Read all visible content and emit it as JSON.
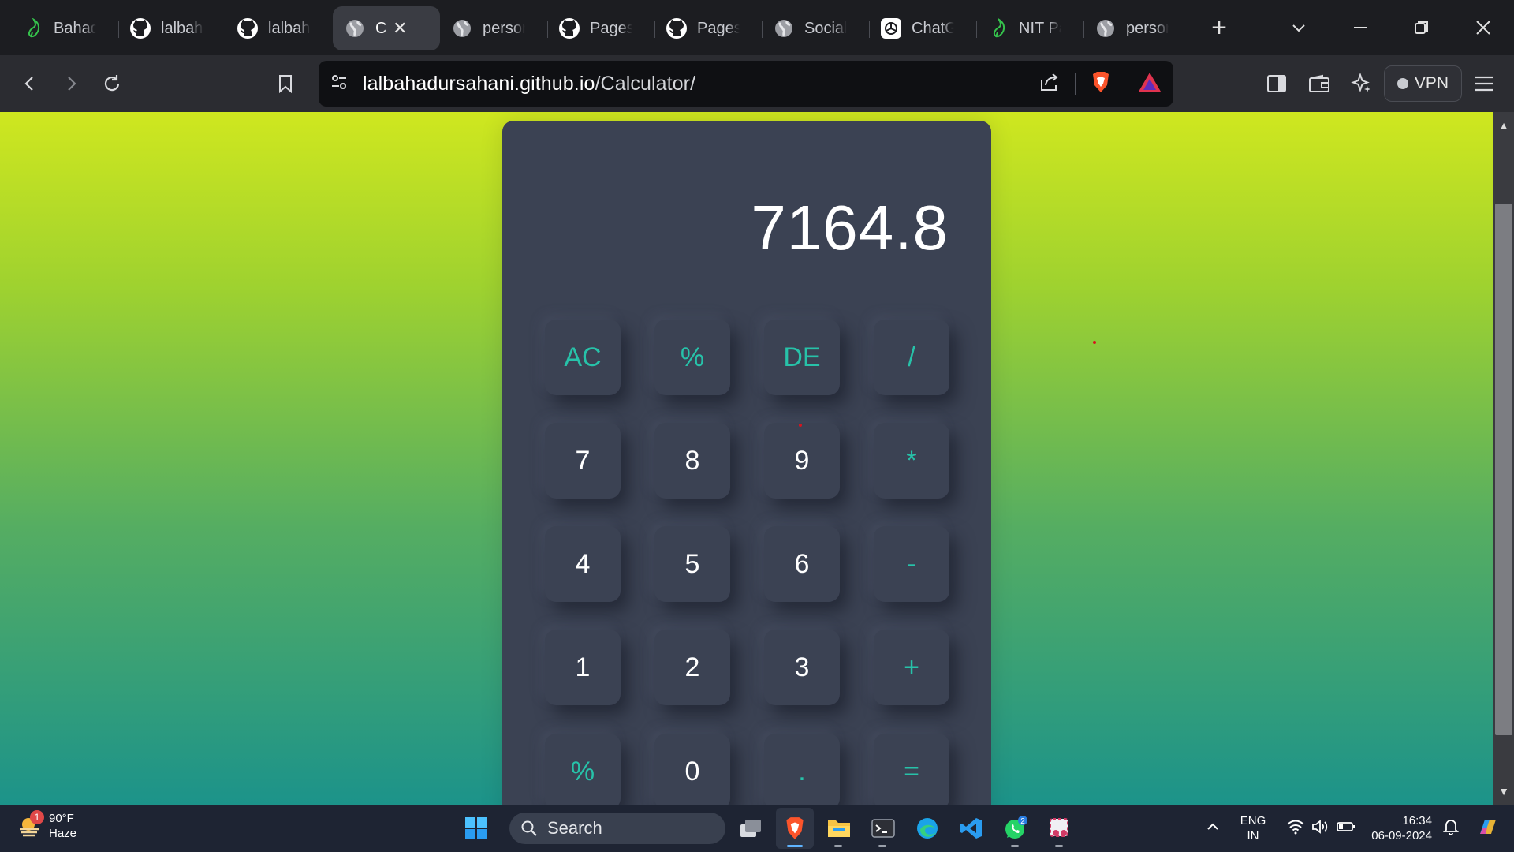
{
  "browser": {
    "tabs": [
      {
        "title": "Bahadur",
        "icon": "leaf-icon"
      },
      {
        "title": "lalbahadursahani",
        "icon": "github-icon"
      },
      {
        "title": "lalbahadursahani",
        "icon": "github-icon"
      },
      {
        "title": "C",
        "icon": "globe-icon",
        "active": true
      },
      {
        "title": "personal",
        "icon": "globe-icon"
      },
      {
        "title": "Pages",
        "icon": "github-icon"
      },
      {
        "title": "Pages",
        "icon": "github-icon"
      },
      {
        "title": "Social",
        "icon": "globe-icon"
      },
      {
        "title": "ChatGPT",
        "icon": "chatgpt-icon"
      },
      {
        "title": "NIT Patna",
        "icon": "leaf-icon"
      },
      {
        "title": "personal",
        "icon": "globe-icon"
      }
    ],
    "url": {
      "domain": "lalbahadursahani.github.io",
      "path": "/Calculator/"
    },
    "vpn_label": "VPN"
  },
  "calculator": {
    "display": "7164.8",
    "keys": [
      {
        "label": "AC",
        "type": "op"
      },
      {
        "label": "%",
        "type": "op"
      },
      {
        "label": "DE",
        "type": "op"
      },
      {
        "label": "/",
        "type": "op"
      },
      {
        "label": "7",
        "type": "num"
      },
      {
        "label": "8",
        "type": "num"
      },
      {
        "label": "9",
        "type": "num"
      },
      {
        "label": "*",
        "type": "op"
      },
      {
        "label": "4",
        "type": "num"
      },
      {
        "label": "5",
        "type": "num"
      },
      {
        "label": "6",
        "type": "num"
      },
      {
        "label": "-",
        "type": "op"
      },
      {
        "label": "1",
        "type": "num"
      },
      {
        "label": "2",
        "type": "num"
      },
      {
        "label": "3",
        "type": "num"
      },
      {
        "label": "+",
        "type": "op"
      },
      {
        "label": "%",
        "type": "op"
      },
      {
        "label": "0",
        "type": "num"
      },
      {
        "label": ".",
        "type": "op"
      },
      {
        "label": "=",
        "type": "op"
      }
    ]
  },
  "taskbar": {
    "weather": {
      "temp": "90°F",
      "condition": "Haze",
      "badge": "1"
    },
    "search_label": "Search",
    "whatsapp_badge": "2",
    "lang_top": "ENG",
    "lang_bottom": "IN",
    "time": "16:34",
    "date": "06-09-2024"
  },
  "colors": {
    "accent_key": "#27c2a9",
    "calc_body": "#3b4253",
    "gradient_top": "#cfe71f",
    "gradient_bottom": "#1c938a"
  }
}
